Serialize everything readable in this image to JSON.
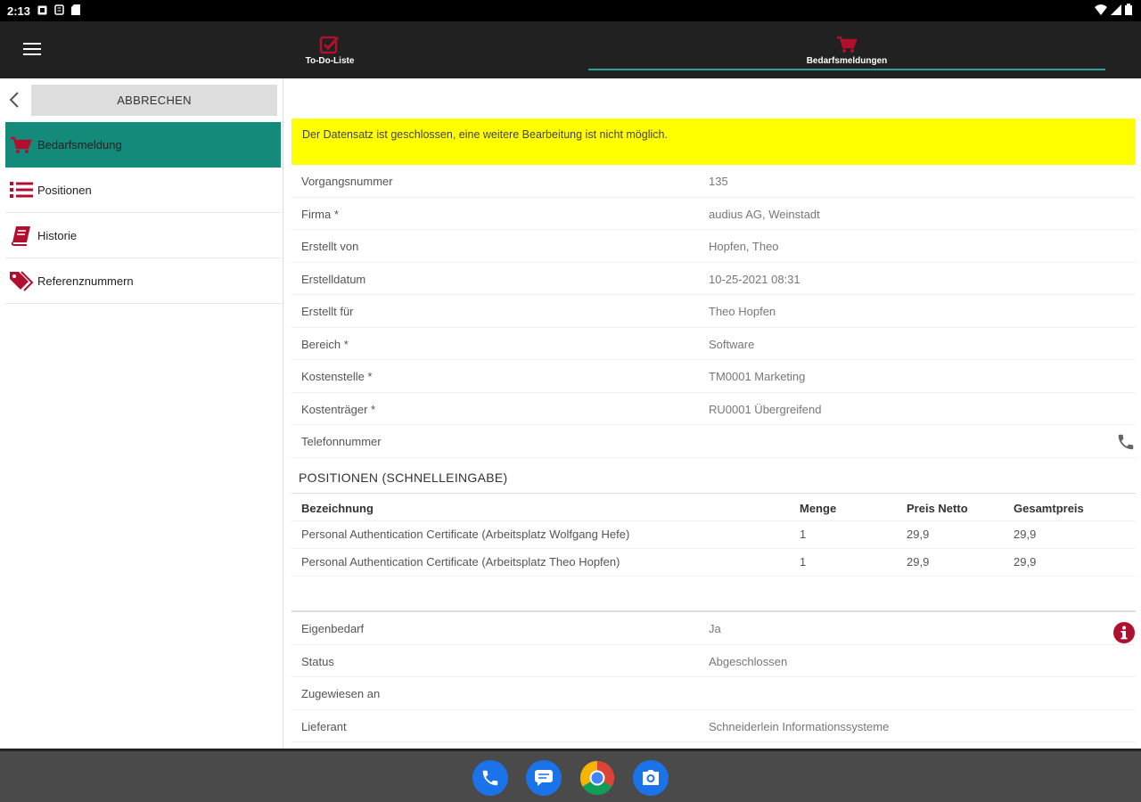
{
  "status_bar": {
    "time": "2:13"
  },
  "tabs": [
    {
      "label": "To-Do-Liste",
      "active": false
    },
    {
      "label": "Bedarfsmeldungen",
      "active": true
    }
  ],
  "sidebar": {
    "cancel_label": "ABBRECHEN",
    "items": [
      {
        "label": "Bedarfsmeldung",
        "icon": "cart-icon",
        "active": true
      },
      {
        "label": "Positionen",
        "icon": "list-icon",
        "active": false
      },
      {
        "label": "Historie",
        "icon": "book-icon",
        "active": false
      },
      {
        "label": "Referenznummern",
        "icon": "tags-icon",
        "active": false
      }
    ]
  },
  "banner": {
    "text": "Der Datensatz ist geschlossen, eine weitere Bearbeitung ist nicht möglich."
  },
  "fields": [
    {
      "label": "Vorgangsnummer",
      "value": "135"
    },
    {
      "label": "Firma *",
      "value": "audius AG, Weinstadt"
    },
    {
      "label": "Erstellt von",
      "value": "Hopfen, Theo"
    },
    {
      "label": "Erstelldatum",
      "value": "10-25-2021 08:31"
    },
    {
      "label": "Erstellt für",
      "value": "Theo Hopfen"
    },
    {
      "label": "Bereich *",
      "value": "Software"
    },
    {
      "label": "Kostenstelle *",
      "value": "TM0001 Marketing"
    },
    {
      "label": "Kostenträger *",
      "value": "RU0001 Übergreifend"
    },
    {
      "label": "Telefonnummer",
      "value": ""
    }
  ],
  "positions": {
    "title": "POSITIONEN (SCHNELLEINGABE)",
    "columns": [
      "Bezeichnung",
      "Menge",
      "Preis Netto",
      "Gesamtpreis"
    ],
    "rows": [
      [
        "Personal Authentication Certificate (Arbeitsplatz Wolfgang Hefe)",
        "1",
        "29,9",
        "29,9"
      ],
      [
        "Personal Authentication Certificate (Arbeitsplatz Theo Hopfen)",
        "1",
        "29,9",
        "29,9"
      ]
    ]
  },
  "fields2": [
    {
      "label": "Eigenbedarf",
      "value": "Ja"
    },
    {
      "label": "Status",
      "value": "Abgeschlossen"
    },
    {
      "label": "Zugewiesen an",
      "value": ""
    },
    {
      "label": "Lieferant",
      "value": "Schneiderlein Informationssysteme"
    }
  ],
  "colors": {
    "accent": "#138a7a",
    "brand_red": "#b0102e",
    "banner": "#ffff00",
    "appbar": "#212121"
  },
  "dock": [
    "phone-app-icon",
    "messages-app-icon",
    "chrome-app-icon",
    "camera-app-icon"
  ]
}
